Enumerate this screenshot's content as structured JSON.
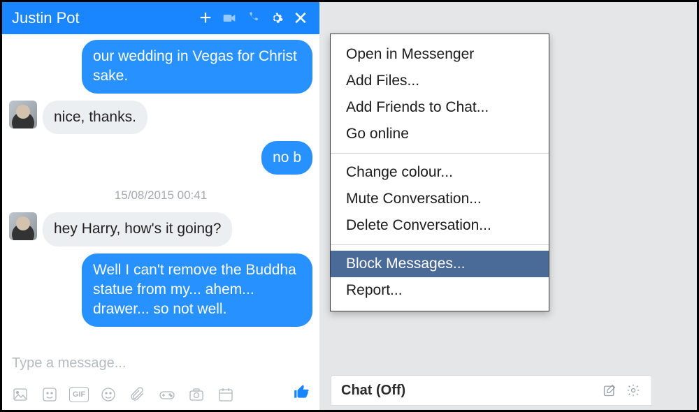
{
  "header": {
    "contact_name": "Justin Pot"
  },
  "messages": {
    "m1": "our wedding in Vegas for Christ sake.",
    "m2": "nice, thanks.",
    "m3": "no b",
    "ts": "15/08/2015 00:41",
    "m4": "hey Harry, how's it going?",
    "m5": "Well I can't remove the Buddha statue from my... ahem... drawer... so not well."
  },
  "composer": {
    "placeholder": "Type a message...",
    "gif_label": "GIF"
  },
  "menu": {
    "open_in_messenger": "Open in Messenger",
    "add_files": "Add Files...",
    "add_friends": "Add Friends to Chat...",
    "go_online": "Go online",
    "change_colour": "Change colour...",
    "mute": "Mute Conversation...",
    "delete": "Delete Conversation...",
    "block": "Block Messages...",
    "report": "Report..."
  },
  "sidebar": {
    "chat_off": "Chat (Off)"
  }
}
